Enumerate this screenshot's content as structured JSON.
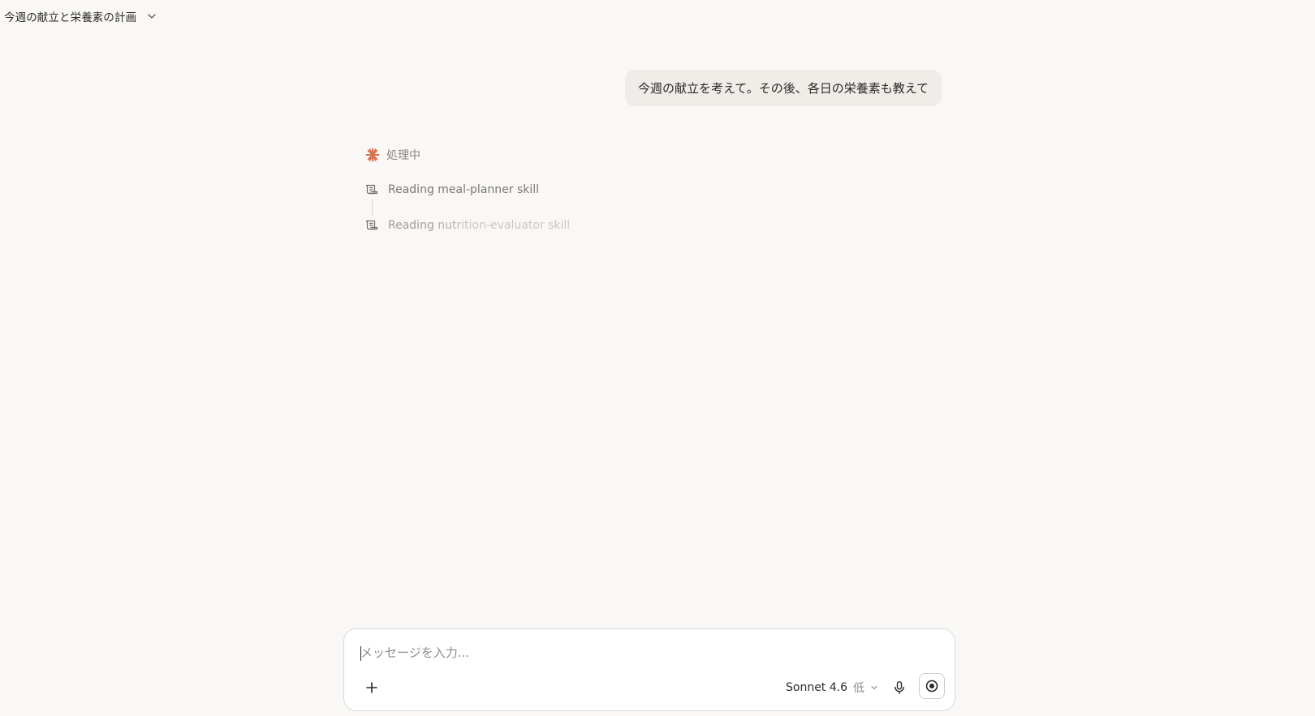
{
  "header": {
    "title": "今週の献立と栄養素の計画"
  },
  "conversation": {
    "user_message": "今週の献立を考えて。その後、各日の栄養素も教えて",
    "status_label": "処理中",
    "steps": [
      {
        "label": "Reading meal-planner skill"
      },
      {
        "label": "Reading nutrition-evaluator skill"
      }
    ]
  },
  "composer": {
    "placeholder": "メッセージを入力...",
    "value": "",
    "model_name": "Sonnet 4.6",
    "effort_label": "低"
  },
  "icons": {
    "title_chevron": "chevron-down-icon",
    "status": "spark-icon",
    "step": "skill-file-icon",
    "add": "plus-icon",
    "mic": "microphone-icon",
    "record": "record-icon"
  },
  "colors": {
    "background": "#f9f8f6",
    "user_bubble": "#efede8",
    "accent_spark": "#d9734f",
    "muted_text": "#8b8984"
  }
}
